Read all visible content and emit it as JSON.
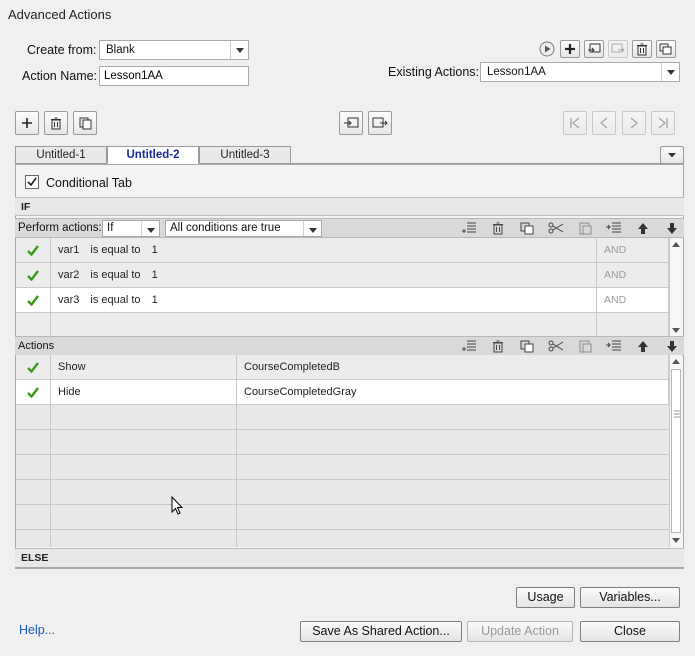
{
  "window": {
    "title": "Advanced Actions"
  },
  "create_from": {
    "label": "Create from:",
    "value": "Blank"
  },
  "action_name": {
    "label": "Action Name:",
    "value": "Lesson1AA"
  },
  "existing_actions": {
    "label": "Existing Actions:",
    "value": "Lesson1AA"
  },
  "tabs": [
    {
      "label": "Untitled-1",
      "active": false
    },
    {
      "label": "Untitled-2",
      "active": true
    },
    {
      "label": "Untitled-3",
      "active": false
    }
  ],
  "conditional_tab": {
    "label": "Conditional Tab",
    "checked": true
  },
  "if_section": {
    "label": "IF"
  },
  "perform_actions": {
    "label": "Perform actions:",
    "mode": "If",
    "condition": "All conditions are true"
  },
  "conditions": [
    {
      "variable": "var1",
      "operator": "is equal to",
      "value": "1",
      "logic": "AND"
    },
    {
      "variable": "var2",
      "operator": "is equal to",
      "value": "1",
      "logic": "AND"
    },
    {
      "variable": "var3",
      "operator": "is equal to",
      "value": "1",
      "logic": "AND"
    }
  ],
  "actions_section": {
    "label": "Actions"
  },
  "actions": [
    {
      "command": "Show",
      "target": "CourseCompletedB"
    },
    {
      "command": "Hide",
      "target": "CourseCompletedGray"
    }
  ],
  "else_section": {
    "label": "ELSE"
  },
  "buttons": {
    "usage": "Usage",
    "variables": "Variables...",
    "save_shared": "Save As Shared Action...",
    "update_action": "Update Action",
    "close": "Close"
  },
  "help_link": "Help...",
  "colors": {
    "check": "#3a9b1a",
    "active_tab": "#1a2a9a",
    "link": "#1c55b8"
  }
}
